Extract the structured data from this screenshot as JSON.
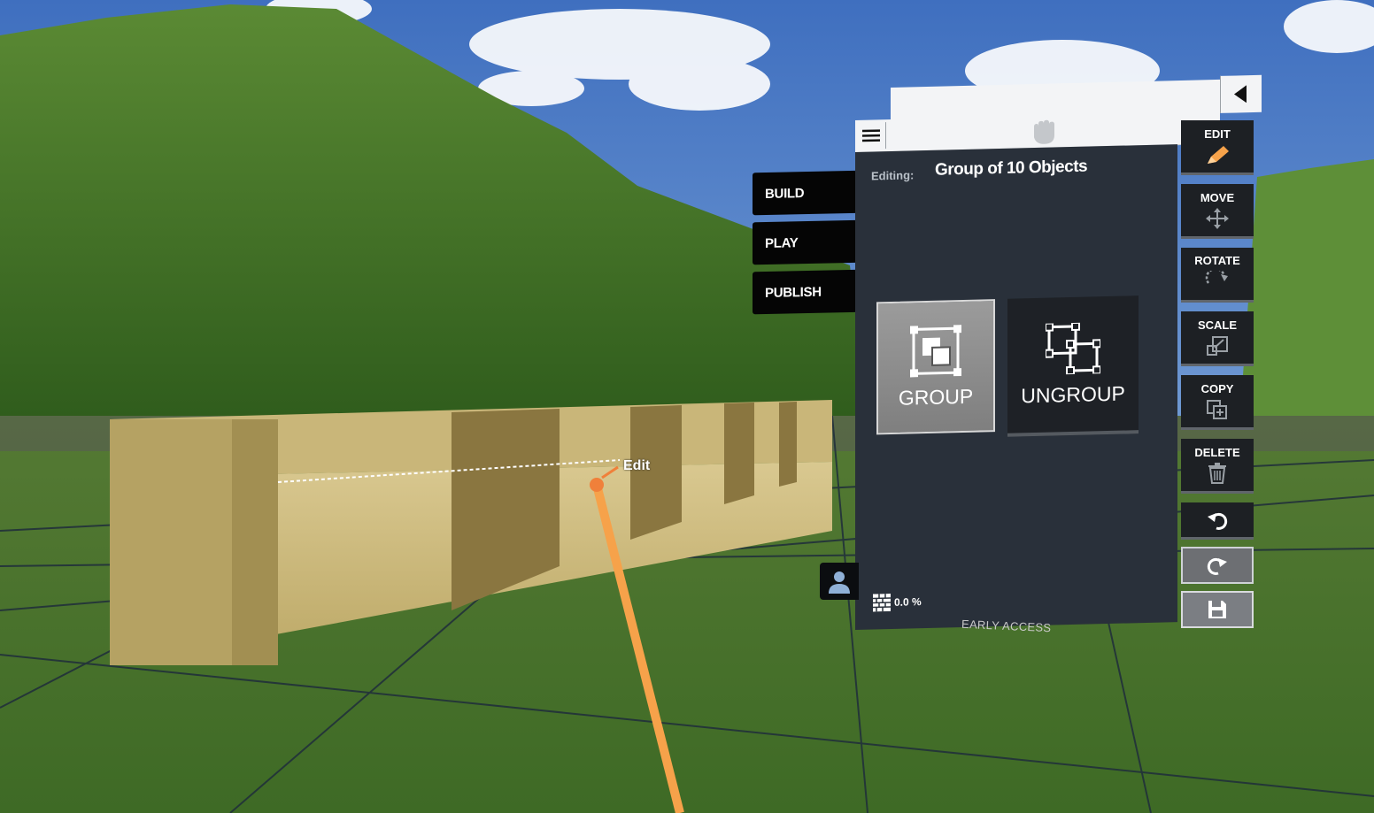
{
  "mode_tabs": [
    "BUILD",
    "PLAY",
    "PUBLISH"
  ],
  "panel": {
    "editing_label": "Editing:",
    "editing_value": "Group of 10 Objects",
    "group_label": "GROUP",
    "ungroup_label": "UNGROUP",
    "progress_value": "0.0 %"
  },
  "tools": {
    "edit": "EDIT",
    "move": "MOVE",
    "rotate": "ROTATE",
    "scale": "SCALE",
    "copy": "COPY",
    "delete": "DELETE"
  },
  "footer": {
    "early_access": "EARLY ACCESS"
  },
  "pointer_tooltip": "Edit",
  "colors": {
    "panel_bg": "#29303a",
    "accent_orange": "#f6a24a",
    "ground_grass": "#4c7a2a",
    "sky": "#6f9ad0"
  }
}
